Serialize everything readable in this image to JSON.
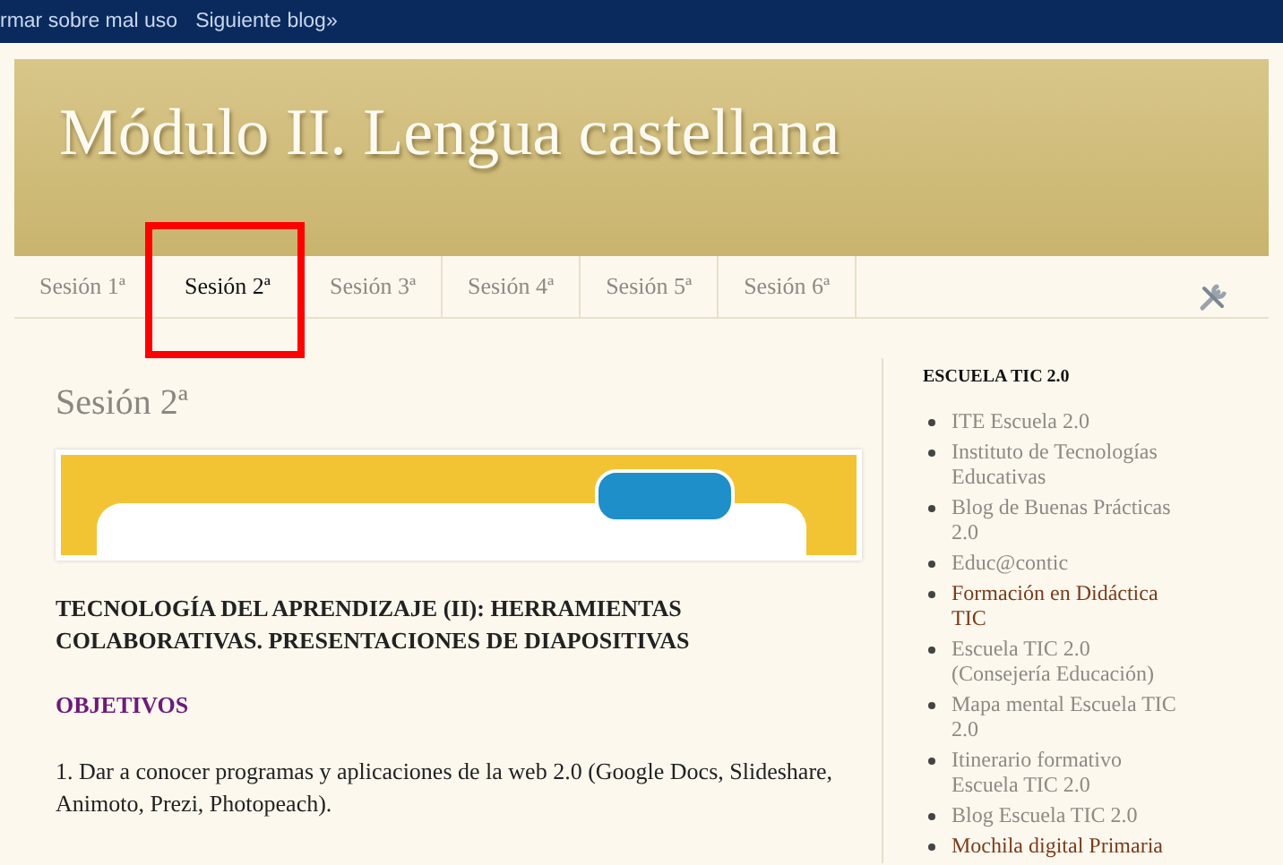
{
  "navbar": {
    "links": [
      "rmar sobre mal uso",
      "Siguiente blog»"
    ]
  },
  "header": {
    "title": "Módulo II. Lengua castellana"
  },
  "tabs": [
    {
      "label": "Sesión 1ª",
      "selected": false,
      "highlighted": false
    },
    {
      "label": "Sesión 2ª",
      "selected": true,
      "highlighted": true
    },
    {
      "label": "Sesión 3ª",
      "selected": false,
      "highlighted": false
    },
    {
      "label": "Sesión 4ª",
      "selected": false,
      "highlighted": false
    },
    {
      "label": "Sesión 5ª",
      "selected": false,
      "highlighted": false
    },
    {
      "label": "Sesión 6ª",
      "selected": false,
      "highlighted": false
    }
  ],
  "post": {
    "title": "Sesión 2ª",
    "heading": "TECNOLOGÍA DEL APRENDIZAJE (II): HERRAMIENTAS COLABORATIVAS. PRESENTACIONES DE DIAPOSITIVAS",
    "subheading": "OBJETIVOS",
    "paragraph": "1. Dar a conocer programas y aplicaciones de la web 2.0 (Google Docs, Slideshare, Animoto, Prezi, Photopeach)."
  },
  "sidebar": {
    "title": "ESCUELA TIC 2.0",
    "links": [
      {
        "label": "ITE Escuela 2.0",
        "visited": true
      },
      {
        "label": "Instituto de Tecnologías Educativas",
        "visited": true
      },
      {
        "label": "Blog de Buenas Prácticas 2.0",
        "visited": true
      },
      {
        "label": "Educ@contic",
        "visited": true
      },
      {
        "label": "Formación en Didáctica TIC",
        "visited": false
      },
      {
        "label": "Escuela TIC 2.0 (Consejería Educación)",
        "visited": true
      },
      {
        "label": "Mapa mental Escuela TIC 2.0",
        "visited": true
      },
      {
        "label": "Itinerario formativo Escuela TIC 2.0",
        "visited": true
      },
      {
        "label": "Blog Escuela TIC 2.0",
        "visited": true
      },
      {
        "label": "Mochila digital Primaria",
        "visited": false
      }
    ]
  }
}
